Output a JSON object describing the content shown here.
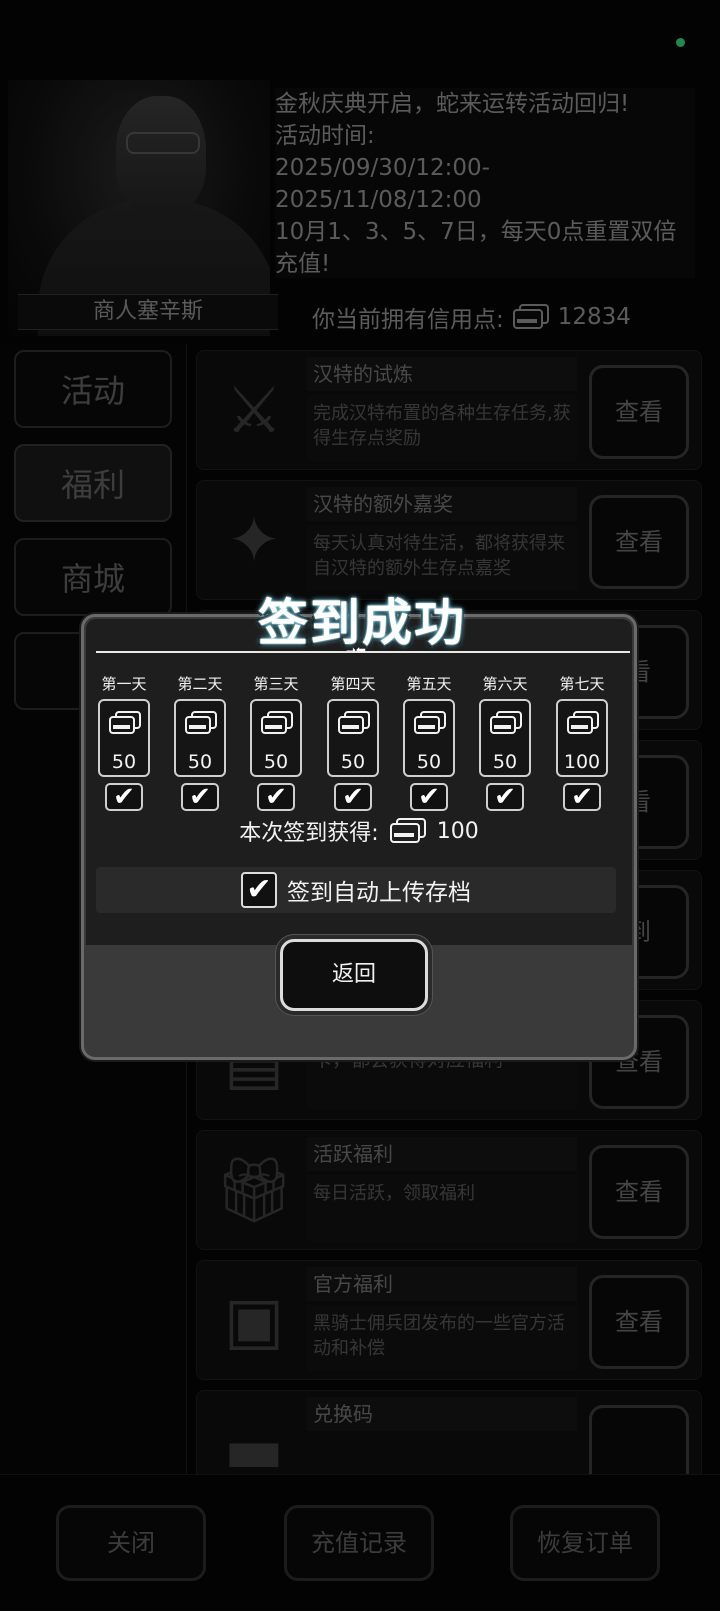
{
  "header": {
    "npc_name": "商人塞辛斯",
    "notice": "金秋庆典开启，蛇来运转活动回归!\n活动时间:\n2025/09/30/12:00-2025/11/08/12:00\n10月1、3、5、7日，每天0点重置双倍充值!",
    "credits_label": "你当前拥有信用点:",
    "credits_value": "12834"
  },
  "tabs": [
    {
      "label": "活动"
    },
    {
      "label": "福利"
    },
    {
      "label": "商城"
    },
    {
      "label": "充"
    }
  ],
  "activities": [
    {
      "title": "汉特的试炼",
      "desc": "完成汉特布置的各种生存任务,获得生存点奖励",
      "button": "查看",
      "icon": "sword-emblem-icon"
    },
    {
      "title": "汉特的额外嘉奖",
      "desc": "每天认真对待生活，都将获得来自汉特的额外生存点嘉奖",
      "button": "查看",
      "icon": "treasure-icon"
    },
    {
      "title": "",
      "desc": "",
      "button": "看",
      "icon": ""
    },
    {
      "title": "",
      "desc": "",
      "button": "看",
      "icon": ""
    },
    {
      "title": "",
      "desc": "",
      "button": "到",
      "icon": ""
    },
    {
      "title": "",
      "desc": "购买对应周卡、小月卡、大月卡，都会获得对应福利",
      "button": "查看",
      "icon": "card-pack-icon"
    },
    {
      "title": "活跃福利",
      "desc": "每日活跃，领取福利",
      "button": "查看",
      "icon": "gift-icon"
    },
    {
      "title": "官方福利",
      "desc": "黑骑士佣兵团发布的一些官方活动和补偿",
      "button": "查看",
      "icon": "gift-box-icon"
    },
    {
      "title": "兑换码",
      "desc": "",
      "button": "",
      "icon": "redeem-icon"
    }
  ],
  "bottom": {
    "close": "关闭",
    "recharge_record": "充值记录",
    "restore_order": "恢复订单"
  },
  "dialog": {
    "title": "签到成功",
    "days": [
      {
        "label": "第一天",
        "amount": "50"
      },
      {
        "label": "第二天",
        "amount": "50"
      },
      {
        "label": "第三天",
        "amount": "50"
      },
      {
        "label": "第四天",
        "amount": "50"
      },
      {
        "label": "第五天",
        "amount": "50"
      },
      {
        "label": "第六天",
        "amount": "50"
      },
      {
        "label": "第七天",
        "amount": "100"
      }
    ],
    "reward_label": "本次签到获得:",
    "reward_value": "100",
    "autosave_label": "签到自动上传存档",
    "back_button": "返回"
  }
}
